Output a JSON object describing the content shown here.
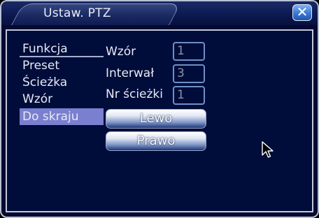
{
  "window": {
    "title": "Ustaw. PTZ"
  },
  "menu": {
    "header": "Funkcja",
    "items": [
      {
        "label": "Preset",
        "selected": false
      },
      {
        "label": "Ścieżka",
        "selected": false
      },
      {
        "label": "Wzór",
        "selected": false
      },
      {
        "label": "Do skraju",
        "selected": true
      }
    ]
  },
  "fields": [
    {
      "label": "Wzór",
      "value": "1"
    },
    {
      "label": "Interwał",
      "value": "3"
    },
    {
      "label": "Nr ścieżki",
      "value": "1"
    }
  ],
  "buttons": {
    "left": "Lewo",
    "right": "Prawo"
  },
  "icons": {
    "close": "close-icon",
    "cursor": "mouse-cursor-icon"
  },
  "colors": {
    "background": "#000c3a",
    "selection": "#7b7fcf",
    "accent": "#3a78d4"
  }
}
